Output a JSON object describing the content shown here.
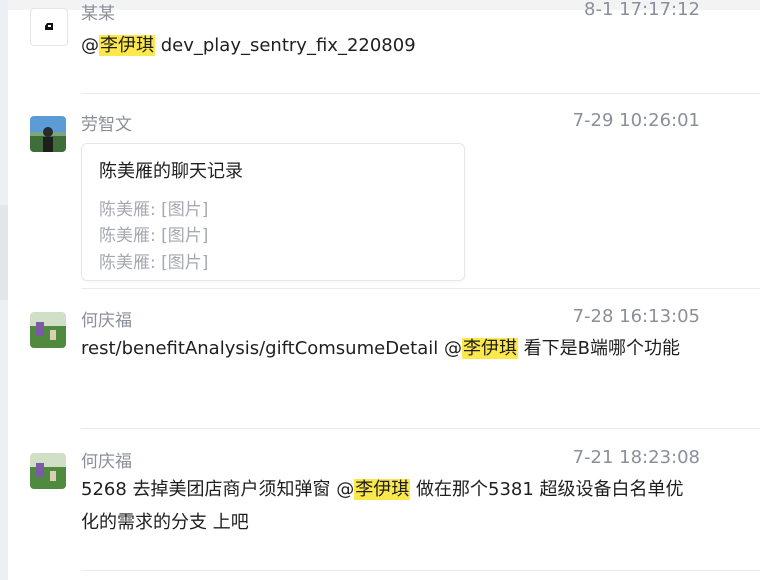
{
  "messages": [
    {
      "sender": "某某",
      "time": "8-1 17:17:12",
      "mention_prefix": "@",
      "mention": "李伊琪",
      "after": " dev_play_sentry_fix_220809"
    },
    {
      "sender": "劳智文",
      "time": "7-29 10:26:01",
      "card": {
        "title": "陈美雁的聊天记录",
        "lines": [
          "陈美雁: [图片]",
          "陈美雁: [图片]",
          "陈美雁: [图片]"
        ]
      }
    },
    {
      "sender": "何庆福",
      "time": "7-28 16:13:05",
      "before": "rest/benefitAnalysis/giftComsumeDetail @",
      "mention": "李伊琪",
      "after": " 看下是B端哪个功能"
    },
    {
      "sender": "何庆福",
      "time": "7-21 18:23:08",
      "before": "5268 去掉美团店商户须知弹窗 @",
      "mention": "李伊琪",
      "after": " 做在那个5381 超级设备白名单优化的需求的分支 上吧"
    }
  ],
  "colors": {
    "mention_highlight": "#fde84c",
    "meta_text": "#8a8f99",
    "card_muted_text": "#a5a9b0"
  },
  "icons": {
    "avatar_1": "app-logo-avatar",
    "avatar_2": "person-landscape-avatar",
    "avatar_3": "field-avatar",
    "avatar_4": "field-avatar"
  }
}
